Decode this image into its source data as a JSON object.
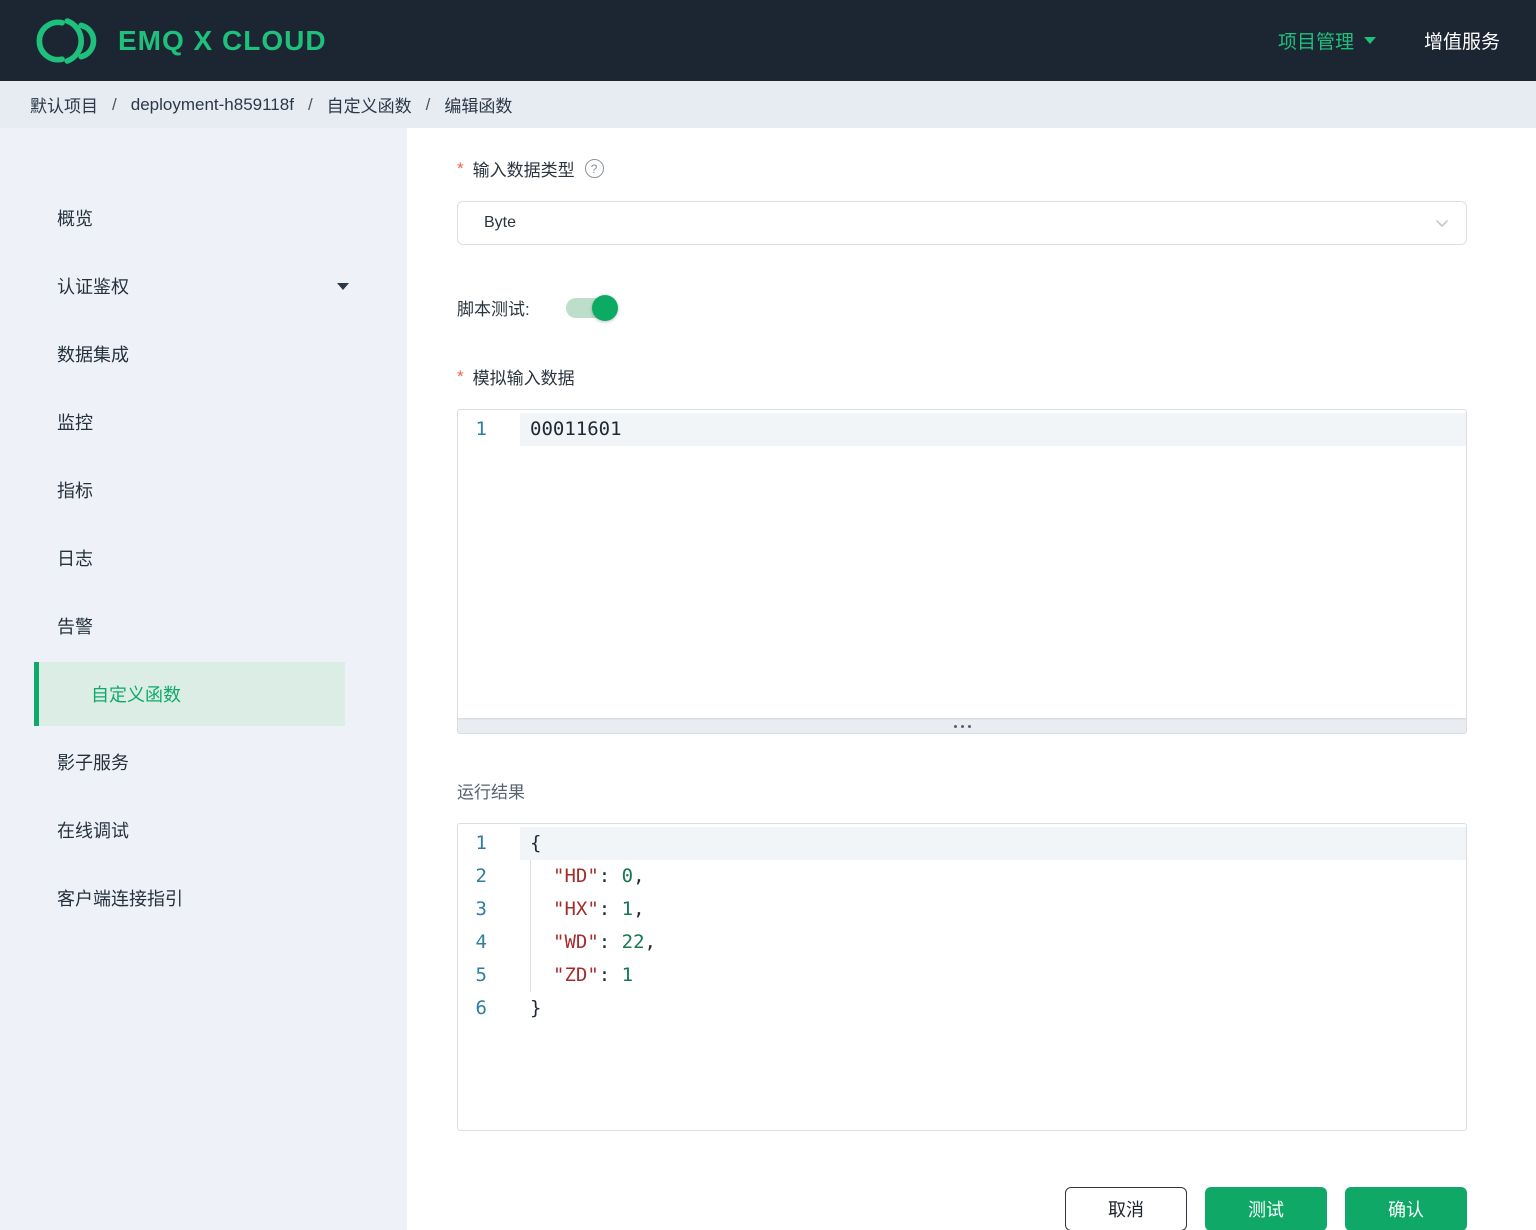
{
  "header": {
    "brand": "EMQ X CLOUD",
    "project_menu": "项目管理",
    "value_services": "增值服务"
  },
  "breadcrumb": {
    "separator": "/",
    "items": [
      "默认项目",
      "deployment-h859118f",
      "自定义函数",
      "编辑函数"
    ]
  },
  "sidebar": {
    "items": [
      {
        "label": "概览"
      },
      {
        "label": "认证鉴权",
        "has_submenu": true
      },
      {
        "label": "数据集成"
      },
      {
        "label": "监控"
      },
      {
        "label": "指标"
      },
      {
        "label": "日志"
      },
      {
        "label": "告警"
      },
      {
        "label": "自定义函数",
        "active": true
      },
      {
        "label": "影子服务"
      },
      {
        "label": "在线调试"
      },
      {
        "label": "客户端连接指引"
      }
    ]
  },
  "form": {
    "required_mark": "*",
    "input_type_label": "输入数据类型",
    "input_type_value": "Byte",
    "script_test_label": "脚本测试:",
    "script_test_enabled": true,
    "mock_input_label": "模拟输入数据",
    "result_label": "运行结果"
  },
  "icons": {
    "help_glyph": "?"
  },
  "editor1": {
    "lines": [
      {
        "num": "1",
        "code": "00011601"
      }
    ]
  },
  "editor2": {
    "lines": [
      {
        "num": "1",
        "open": "{"
      },
      {
        "num": "2",
        "key": "\"HD\"",
        "colon": ": ",
        "value": "0",
        "comma": ","
      },
      {
        "num": "3",
        "key": "\"HX\"",
        "colon": ": ",
        "value": "1",
        "comma": ","
      },
      {
        "num": "4",
        "key": "\"WD\"",
        "colon": ": ",
        "value": "22",
        "comma": ","
      },
      {
        "num": "5",
        "key": "\"ZD\"",
        "colon": ": ",
        "value": "1",
        "comma": ""
      },
      {
        "num": "6",
        "close": "}"
      }
    ]
  },
  "actions": {
    "cancel": "取消",
    "test": "测试",
    "confirm": "确认"
  },
  "colors": {
    "header_bg": "#1C2633",
    "brand_green": "#1EC07C",
    "accent_green": "#0FA866",
    "sidebar_active_bg": "#DBEDE5",
    "json_key": "#A32D2D",
    "json_number": "#15784E",
    "line_number": "#2F7EA0"
  }
}
